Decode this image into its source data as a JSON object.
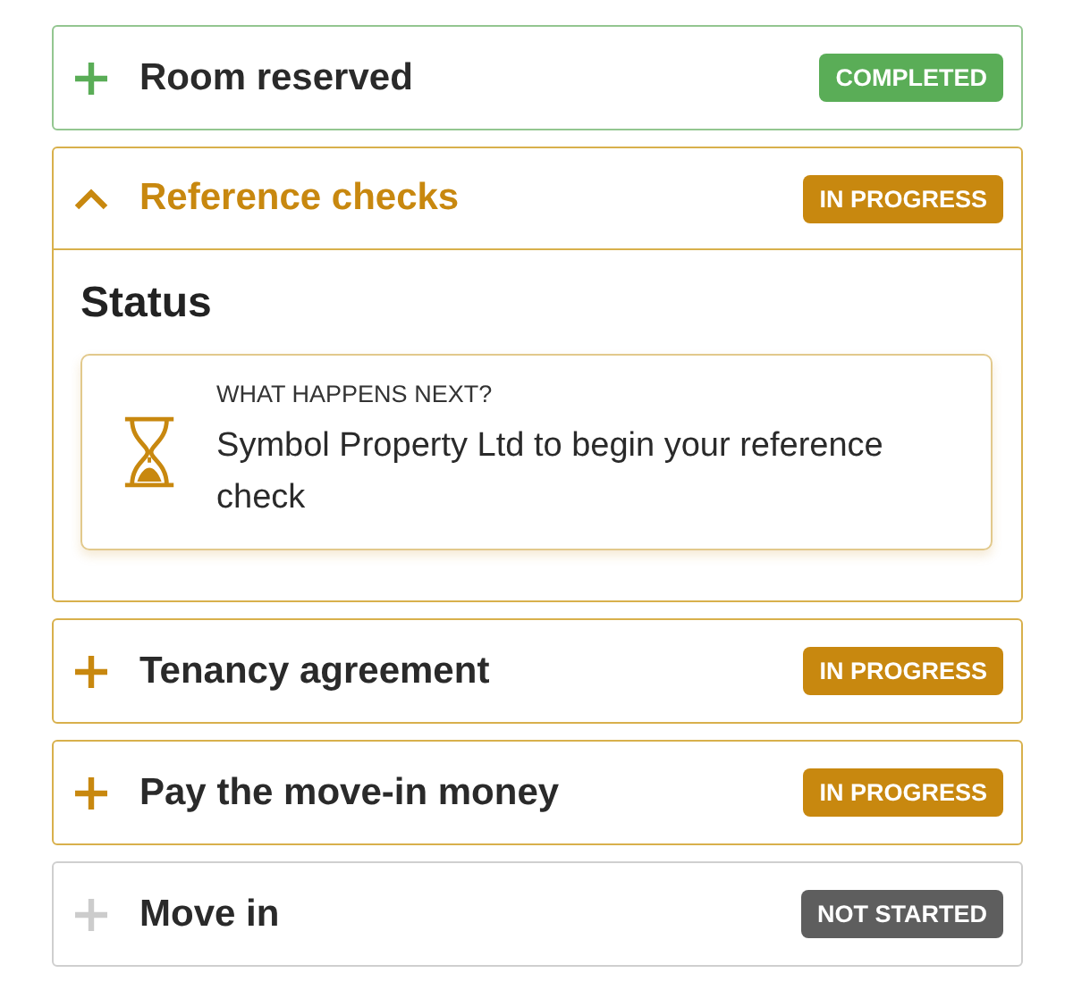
{
  "steps": [
    {
      "title": "Room reserved",
      "kind": "completed",
      "badge": "COMPLETED",
      "expanded": false
    },
    {
      "title": "Reference checks",
      "kind": "progress",
      "badge": "IN PROGRESS",
      "expanded": true,
      "detail": {
        "heading": "Status",
        "label": "WHAT HAPPENS NEXT?",
        "text": "Symbol Property Ltd to begin your reference check"
      }
    },
    {
      "title": "Tenancy agreement",
      "kind": "progress",
      "badge": "IN PROGRESS",
      "expanded": false
    },
    {
      "title": "Pay the move-in money",
      "kind": "progress",
      "badge": "IN PROGRESS",
      "expanded": false
    },
    {
      "title": "Move in",
      "kind": "pending",
      "badge": "NOT STARTED",
      "expanded": false
    }
  ]
}
